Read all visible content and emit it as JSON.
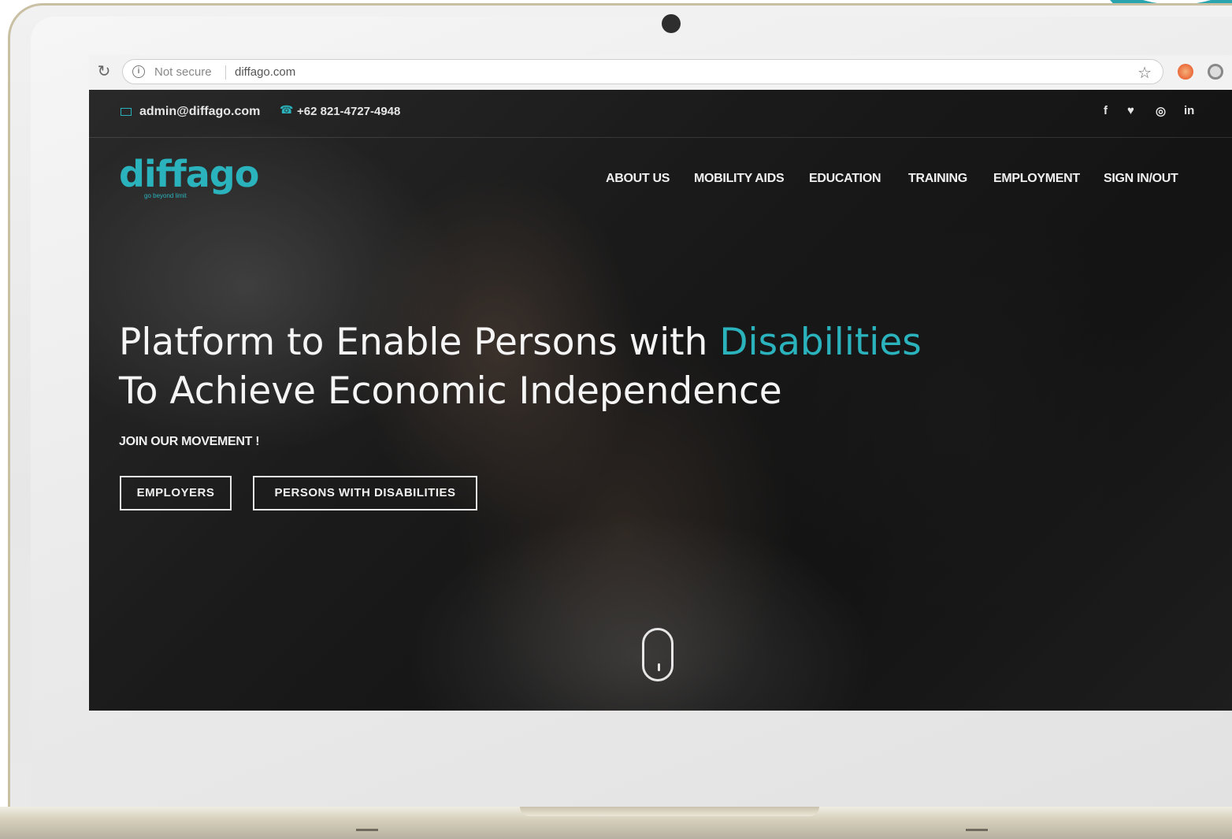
{
  "browser": {
    "security_label": "Not secure",
    "url": "diffago.com"
  },
  "site": {
    "contact": {
      "email": "admin@diffago.com",
      "phone": "+62 821-4727-4948"
    },
    "social": [
      "f",
      "♥",
      "◎",
      "in"
    ],
    "logo": {
      "text": "diffago",
      "tagline": "go beyond limit"
    },
    "nav": [
      "ABOUT US",
      "MOBILITY AIDS",
      "EDUCATION",
      "TRAINING",
      "EMPLOYMENT",
      "SIGN IN/OUT"
    ],
    "hero": {
      "headline_part1": "Platform to Enable Persons with ",
      "headline_accent": "Disabilities",
      "headline_line2": "To Achieve Economic Independence",
      "subline": "JOIN OUR MOVEMENT !",
      "buttons": [
        "EMPLOYERS",
        "PERSONS WITH DISABILITIES"
      ]
    }
  },
  "colors": {
    "accent": "#2bb3bd",
    "laptop_frame": "#c9bfa3"
  },
  "icons": [
    "reload-icon",
    "info-icon",
    "star-icon",
    "mail-icon",
    "phone-icon",
    "facebook-icon",
    "twitter-icon",
    "instagram-icon",
    "linkedin-icon",
    "scroll-mouse-icon"
  ]
}
